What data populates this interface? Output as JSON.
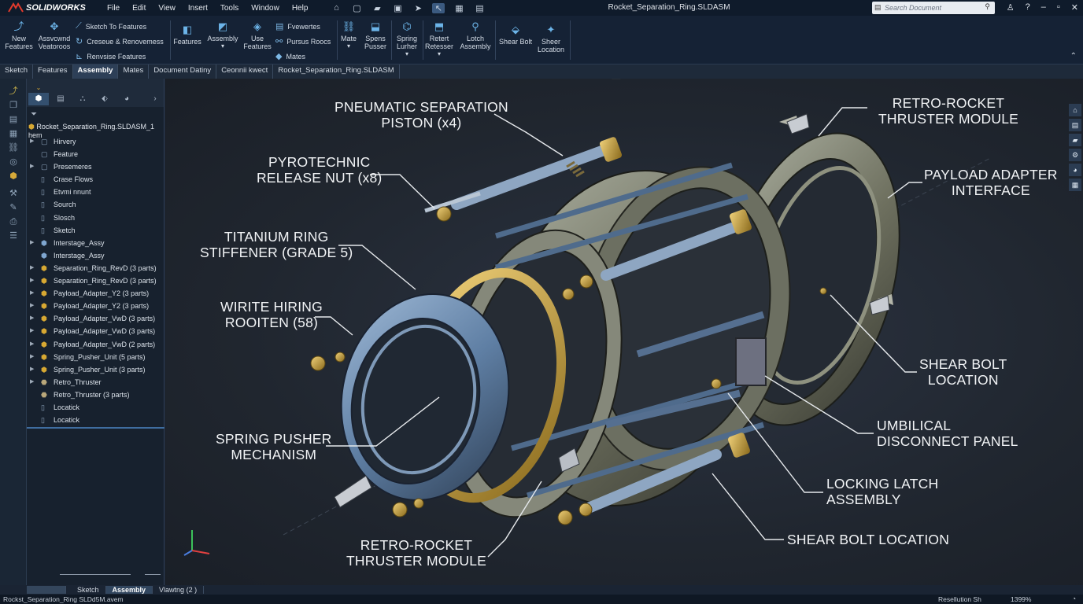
{
  "app": {
    "name": "SOLIDWORKS",
    "window_title": "Rocket_Separation_Ring.SLDASM"
  },
  "menu": [
    "File",
    "Edit",
    "View",
    "Insert",
    "Tools",
    "Window",
    "Help"
  ],
  "search": {
    "placeholder": "Search Document"
  },
  "ribbon": {
    "new_features": "New\nFeatures",
    "assembly_features": "Assvcwnd\nVeatoroos",
    "sketch_to_features": "Sketch To Features",
    "create_renovemess": "Creseue & Renovemess",
    "revise_features": "Renvsise Features",
    "features": "Features",
    "assembly": "Assembly",
    "use_features": "Use\nFeatures",
    "fvewertes": "Fvewertes",
    "pursus_roocs": "Pursus Roocs",
    "mates_small": "Mates",
    "mate": "Mate",
    "spens_pusser": "Spens\nPusser",
    "spring_lurher": "Spring\nLurher",
    "retert_retesser": "Retert\nRetesser",
    "lotch_assembly": "Lotch\nAssembly",
    "shear_bolt": "Shear Bolt",
    "sheer_location": "Sheer\nLocation"
  },
  "tabs": [
    {
      "label": "Sketch",
      "active": false
    },
    {
      "label": "Features",
      "active": false
    },
    {
      "label": "Assembly",
      "active": true
    },
    {
      "label": "Mates",
      "active": false
    },
    {
      "label": "Document Datiny",
      "active": false
    },
    {
      "label": "Ceonnii kwect",
      "active": false
    },
    {
      "label": "Rocket_Separation_Ring.SLDASM",
      "active": false
    }
  ],
  "tree": {
    "root": "Rocket_Separation_Ring.SLDASM_1 hem",
    "items": [
      {
        "label": "Hirvery",
        "arrow": "▶",
        "icon": "doc"
      },
      {
        "label": "Feature",
        "arrow": "",
        "icon": "doc"
      },
      {
        "label": "Presemeres",
        "arrow": "▶",
        "icon": "doc"
      },
      {
        "label": "Crase Flows",
        "arrow": "",
        "icon": "page"
      },
      {
        "label": "Etvmi nnunt",
        "arrow": "",
        "icon": "page"
      },
      {
        "label": "Sourch",
        "arrow": "",
        "icon": "page"
      },
      {
        "label": "Slosch",
        "arrow": "",
        "icon": "page"
      },
      {
        "label": "Sketch",
        "arrow": "",
        "icon": "page"
      },
      {
        "label": "Interstage_Assy",
        "arrow": "▶",
        "icon": "asm"
      },
      {
        "label": "Interstage_Assy",
        "arrow": "",
        "icon": "asm"
      },
      {
        "label": "Separation_Ring_RevD (3 parts)",
        "arrow": "▶",
        "icon": "part"
      },
      {
        "label": "Separation_Ring_RevD (3 parts)",
        "arrow": "▶",
        "icon": "part"
      },
      {
        "label": "Payload_Adapter_Y2 (3 parts)",
        "arrow": "▶",
        "icon": "part"
      },
      {
        "label": "Payload_Adapter_Y2 (3 parts)",
        "arrow": "▶",
        "icon": "part"
      },
      {
        "label": "Payload_Adapter_VwD (3 parts)",
        "arrow": "▶",
        "icon": "part"
      },
      {
        "label": "Payload_Adapter_VwD (3 parts)",
        "arrow": "▶",
        "icon": "part"
      },
      {
        "label": "Payload_Adapter_VwD (2 parts)",
        "arrow": "▶",
        "icon": "part"
      },
      {
        "label": "Spring_Pusher_Unit (5 parts)",
        "arrow": "▶",
        "icon": "part"
      },
      {
        "label": "Spring_Pusher_Unit (3 parts)",
        "arrow": "▶",
        "icon": "part"
      },
      {
        "label": "Retro_Thruster",
        "arrow": "▶",
        "icon": "thr"
      },
      {
        "label": "Retro_Thruster (3 parts)",
        "arrow": "",
        "icon": "thr"
      },
      {
        "label": "Locatick",
        "arrow": "",
        "icon": "page"
      },
      {
        "label": "Locatick",
        "arrow": "",
        "icon": "page"
      }
    ]
  },
  "callouts": {
    "pneumatic": "PNEUMATIC SEPARATION\nPISTON (x4)",
    "pyro": "PYROTECHNIC\nRELEASE NUT (x8)",
    "titanium": "TITANIUM RING\nSTIFFENER (GRADE 5)",
    "wirite": "WIRITE HIRING\nROOITEN (58)",
    "spring": "SPRING PUSHER\nMECHANISM",
    "retro_bottom": "RETRO-ROCKET\nTHRUSTER MODULE",
    "retro_top": "RETRO-ROCKET\nTHRUSTER MODULE",
    "payload": "PAYLOAD ADAPTER\nINTERFACE",
    "shear_right": "SHEAR BOLT\nLOCATION",
    "umbilical": "UMBILICAL\nDISCONNECT PANEL",
    "locking": "LOCKING LATCH\nASSEMBLY",
    "shear_bottom": "SHEAR BOLT LOCATION"
  },
  "bottom_tabs": [
    {
      "label": "Sketch",
      "active": false
    },
    {
      "label": "Assembly",
      "active": true
    },
    {
      "label": "Vlawtng (2 )",
      "active": false
    }
  ],
  "status": {
    "file": "Rockst_Separation_Ring SLDd5M.avem",
    "mode": "Resellution Sh",
    "zoom": "1399%"
  },
  "colors": {
    "accent": "#3b5a80",
    "brand_bg": "#0f1b2b",
    "gold": "#c9a640",
    "steel_blue": "#6f8fb4"
  }
}
